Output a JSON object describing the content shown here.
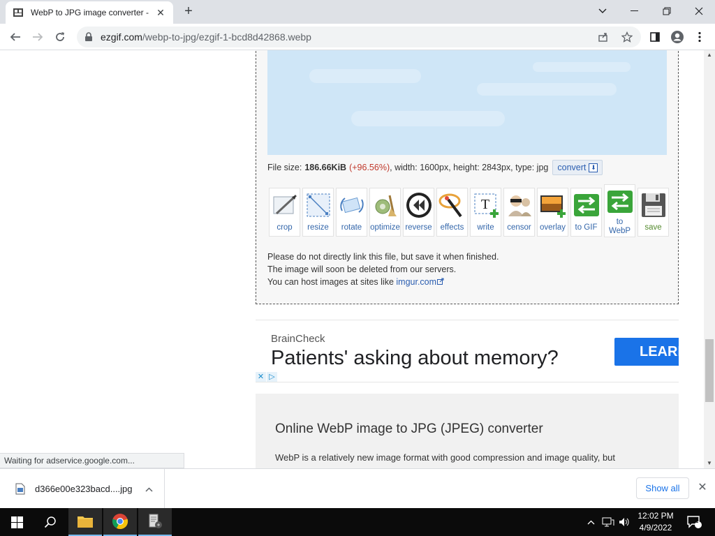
{
  "browser": {
    "tab_title": "WebP to JPG image converter - ",
    "url_host": "ezgif.com",
    "url_path": "/webp-to-jpg/ezgif-1-bcd8d42868.webp"
  },
  "result": {
    "file_size_label": "File size:",
    "file_size_value": "186.66KiB",
    "file_size_change": "(+96.56%)",
    "details": ", width: 1600px, height: 2843px, type: jpg",
    "convert_label": "convert"
  },
  "tools": [
    {
      "name": "crop",
      "icon": "crop-icon",
      "label": "crop"
    },
    {
      "name": "resize",
      "icon": "resize-icon",
      "label": "resize"
    },
    {
      "name": "rotate",
      "icon": "rotate-icon",
      "label": "rotate"
    },
    {
      "name": "optimize",
      "icon": "optimize-icon",
      "label": "optimize"
    },
    {
      "name": "reverse",
      "icon": "reverse-icon",
      "label": "reverse"
    },
    {
      "name": "effects",
      "icon": "effects-icon",
      "label": "effects"
    },
    {
      "name": "write",
      "icon": "write-icon",
      "label": "write"
    },
    {
      "name": "censor",
      "icon": "censor-icon",
      "label": "censor"
    },
    {
      "name": "overlay",
      "icon": "overlay-icon",
      "label": "overlay"
    },
    {
      "name": "to-gif",
      "icon": "to-gif-icon",
      "label": "to GIF"
    },
    {
      "name": "to-webp",
      "icon": "to-webp-icon",
      "label_line1": "to",
      "label_line2": "WebP"
    },
    {
      "name": "save",
      "icon": "save-icon",
      "label": "save"
    }
  ],
  "notes": {
    "line1": "Please do not directly link this file, but save it when finished.",
    "line2": "The image will soon be deleted from our servers.",
    "line3_prefix": "You can host images at sites like ",
    "line3_link": "imgur.com"
  },
  "ad": {
    "brand": "BrainCheck",
    "headline": "Patients' asking about memory?",
    "cta": "LEARN"
  },
  "article": {
    "heading": "Online WebP image to JPG (JPEG) converter",
    "text": "WebP is a relatively new image format with good compression and image quality, but"
  },
  "status_text": "Waiting for adservice.google.com...",
  "downloads": {
    "file_name": "d366e00e323bacd....jpg",
    "show_all": "Show all"
  },
  "taskbar": {
    "time": "12:02 PM",
    "date": "4/9/2022",
    "notification_count": "1"
  },
  "colors": {
    "accent": "#1a73e8",
    "link": "#2a5db0",
    "size_change": "#c0392b",
    "preview_sky": "#cfe6f7"
  }
}
